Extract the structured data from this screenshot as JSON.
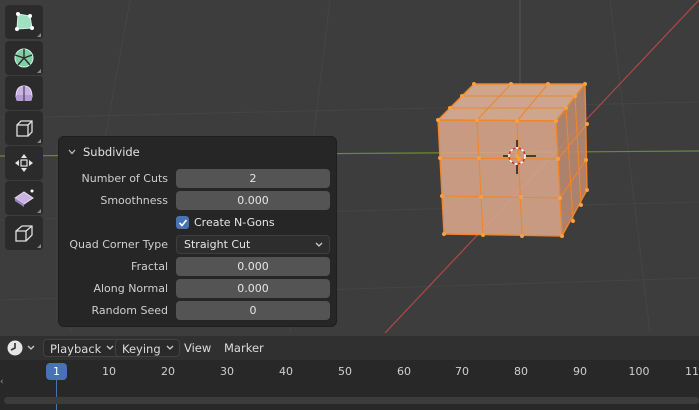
{
  "operator_panel": {
    "title": "Subdivide",
    "fields": {
      "number_of_cuts": {
        "label": "Number of Cuts",
        "value": "2"
      },
      "smoothness": {
        "label": "Smoothness",
        "value": "0.000"
      },
      "create_ngons": {
        "label": "Create N-Gons",
        "checked": true
      },
      "quad_corner_type": {
        "label": "Quad Corner Type",
        "value": "Straight Cut"
      },
      "fractal": {
        "label": "Fractal",
        "value": "0.000"
      },
      "along_normal": {
        "label": "Along Normal",
        "value": "0.000"
      },
      "random_seed": {
        "label": "Random Seed",
        "value": "0"
      }
    }
  },
  "timeline": {
    "menus": {
      "playback": "Playback",
      "keying": "Keying",
      "view": "View",
      "marker": "Marker"
    },
    "current_frame": "1",
    "frame_labels": [
      "10",
      "20",
      "30",
      "40",
      "50",
      "60",
      "70",
      "80",
      "90",
      "100",
      "11"
    ]
  },
  "tools": [
    "select-box-icon",
    "spin-icon",
    "smooth-icon",
    "extrude-icon",
    "transform-icon",
    "shear-icon",
    "bevel-icon"
  ],
  "colors": {
    "accent": "#4772b3",
    "selection_orange": "#f0852a",
    "cube_face": "#d7a48a",
    "x_axis": "#b04848",
    "y_axis": "#6b8a2e"
  }
}
